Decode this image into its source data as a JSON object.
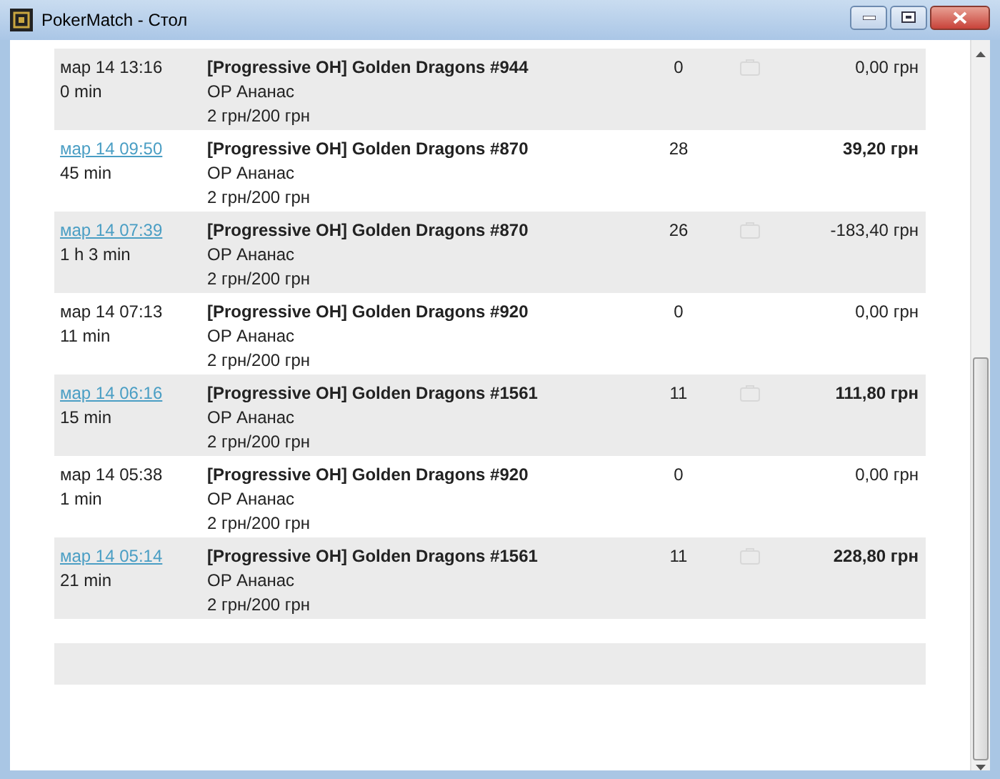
{
  "window": {
    "title": "PokerMatch - Стол"
  },
  "rows": [
    {
      "date": "мар 14 13:16",
      "linked": false,
      "duration": "0 min",
      "table": "[Progressive OH] Golden Dragons #944",
      "player": "OP Ананас",
      "stakes": "2 грн/200 грн",
      "hands": "0",
      "has_icon": true,
      "result": "0,00 грн",
      "bold": false
    },
    {
      "date": "мар 14 09:50",
      "linked": true,
      "duration": "45 min",
      "table": "[Progressive OH] Golden Dragons #870",
      "player": "OP Ананас",
      "stakes": "2 грн/200 грн",
      "hands": "28",
      "has_icon": false,
      "result": "39,20 грн",
      "bold": true
    },
    {
      "date": "мар 14 07:39",
      "linked": true,
      "duration": "1 h 3 min",
      "table": "[Progressive OH] Golden Dragons #870",
      "player": "OP Ананас",
      "stakes": "2 грн/200 грн",
      "hands": "26",
      "has_icon": true,
      "result": "-183,40 грн",
      "bold": false
    },
    {
      "date": "мар 14 07:13",
      "linked": false,
      "duration": "11 min",
      "table": "[Progressive OH] Golden Dragons #920",
      "player": "OP Ананас",
      "stakes": "2 грн/200 грн",
      "hands": "0",
      "has_icon": false,
      "result": "0,00 грн",
      "bold": false
    },
    {
      "date": "мар 14 06:16",
      "linked": true,
      "duration": "15 min",
      "table": "[Progressive OH] Golden Dragons #1561",
      "player": "OP Ананас",
      "stakes": "2 грн/200 грн",
      "hands": "11",
      "has_icon": true,
      "result": "111,80 грн",
      "bold": true
    },
    {
      "date": "мар 14 05:38",
      "linked": false,
      "duration": "1 min",
      "table": "[Progressive OH] Golden Dragons #920",
      "player": "OP Ананас",
      "stakes": "2 грн/200 грн",
      "hands": "0",
      "has_icon": false,
      "result": "0,00 грн",
      "bold": false
    },
    {
      "date": "мар 14 05:14",
      "linked": true,
      "duration": "21 min",
      "table": "[Progressive OH] Golden Dragons #1561",
      "player": "OP Ананас",
      "stakes": "2 грн/200 грн",
      "hands": "11",
      "has_icon": true,
      "result": "228,80 грн",
      "bold": true
    }
  ]
}
